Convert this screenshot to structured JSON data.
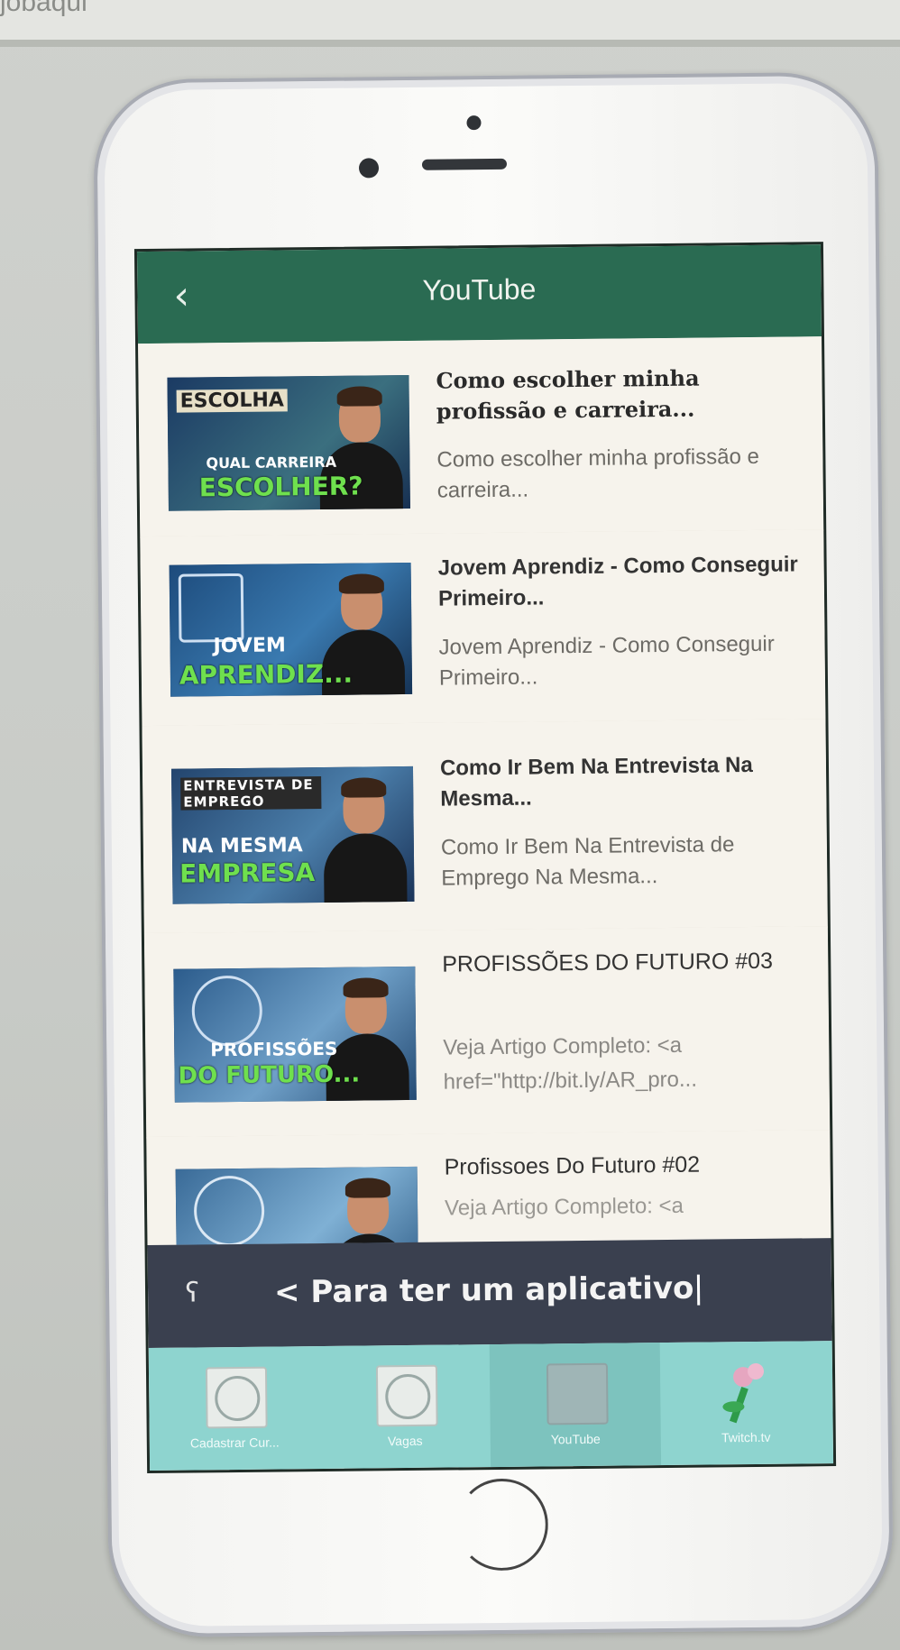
{
  "browser": {
    "top_text": "jobaqui"
  },
  "app": {
    "title": "YouTube"
  },
  "videos": [
    {
      "thumb_line1": "ESCOLHA",
      "thumb_line1b": "QUAL CARREIRA",
      "thumb_line2": "ESCOLHER?",
      "title": "Como escolher minha profissão e carreira...",
      "description": "Como escolher minha profissão e carreira..."
    },
    {
      "thumb_line1": "JOVEM",
      "thumb_line2": "APRENDIZ...",
      "title": "Jovem Aprendiz - Como Conseguir Primeiro...",
      "description": "Jovem Aprendiz - Como Conseguir Primeiro..."
    },
    {
      "thumb_line1": "ENTREVISTA DE EMPREGO",
      "thumb_line1b": "NA MESMA",
      "thumb_line2": "EMPRESA",
      "title": "Como Ir Bem Na Entrevista Na Mesma...",
      "description": "Como Ir Bem Na Entrevista de Emprego Na Mesma..."
    },
    {
      "thumb_line1": "PROFISSÕES",
      "thumb_line2": "DO FUTURO...",
      "title": "PROFISSÕES DO FUTURO #03",
      "description": "Veja Artigo Completo: <a href=\"http://bit.ly/AR_pro..."
    },
    {
      "title": "Profissoes Do Futuro #02",
      "description": "Veja Artigo Completo: <a"
    }
  ],
  "banner": {
    "text": "< Para ter um aplicativo"
  },
  "tabs": [
    {
      "label": "Cadastrar Cur..."
    },
    {
      "label": "Vagas"
    },
    {
      "label": "YouTube"
    },
    {
      "label": "Twitch.tv"
    }
  ]
}
